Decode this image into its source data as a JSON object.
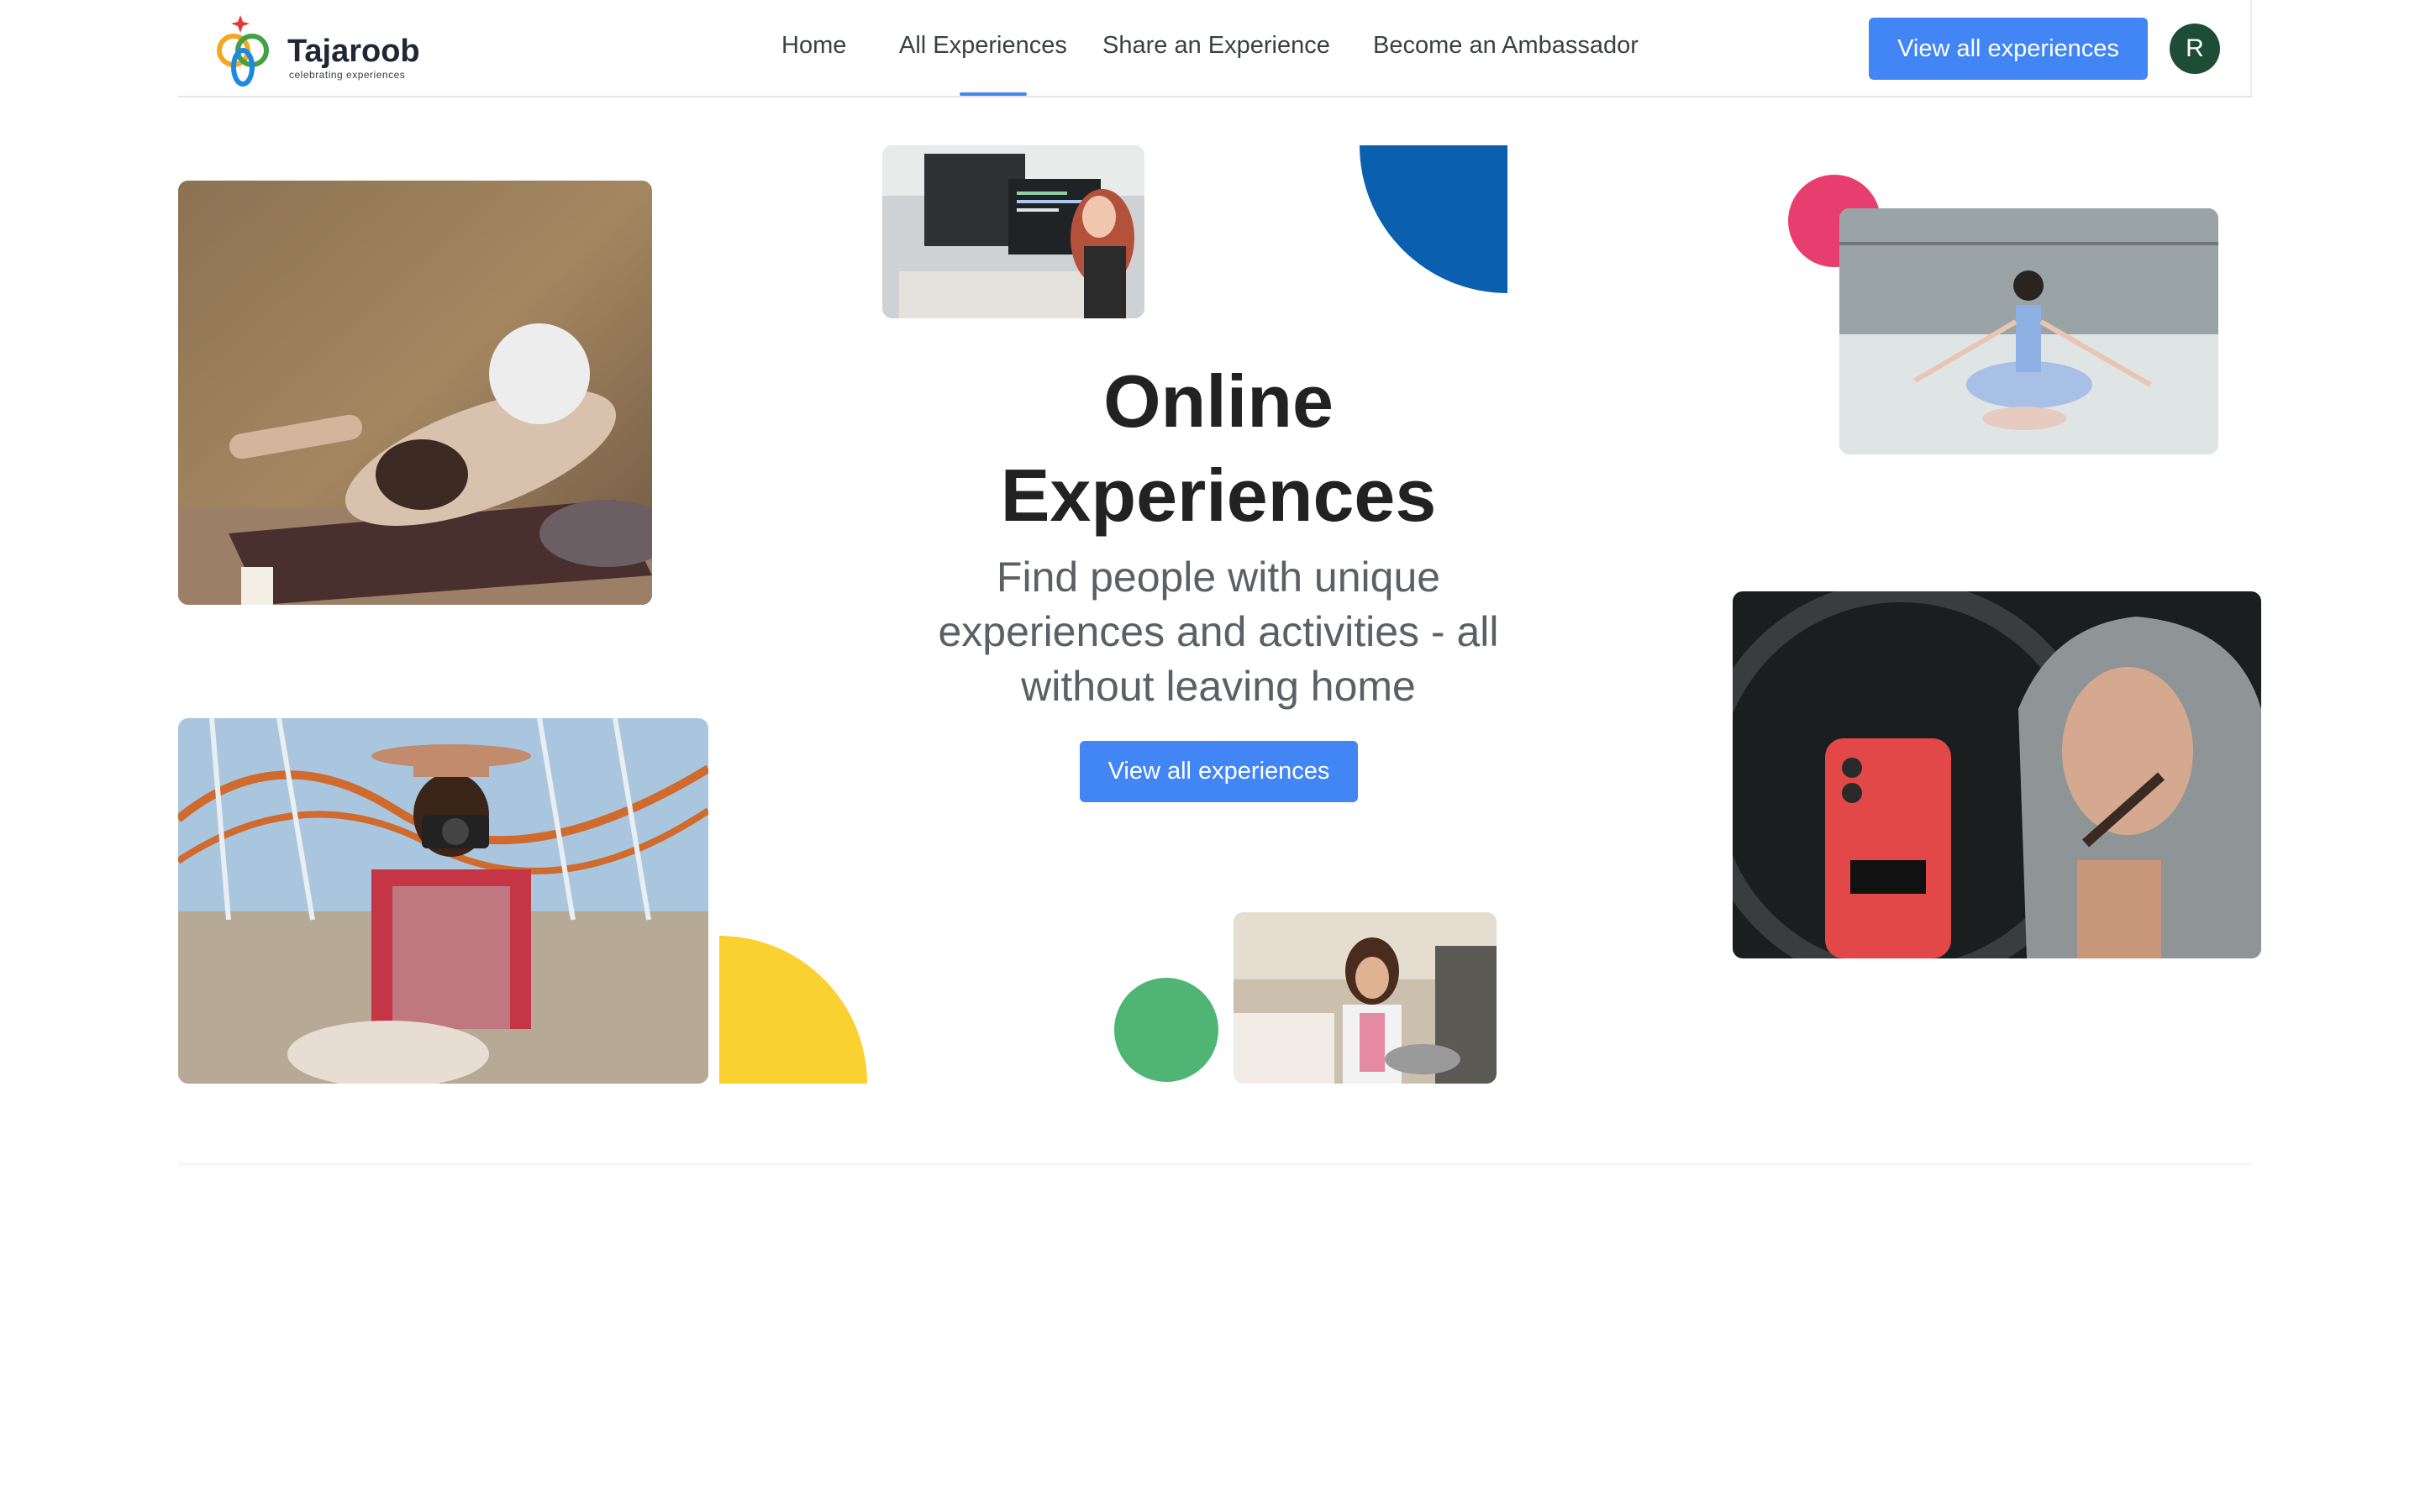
{
  "brand": {
    "name": "Tajaroob",
    "tagline": "celebrating experiences",
    "logo_icon": "trefoil-logo-icon"
  },
  "nav": {
    "items": [
      {
        "label": "Home",
        "active": true
      },
      {
        "label": "All Experiences",
        "active": false
      },
      {
        "label": "Share an Experience",
        "active": false
      },
      {
        "label": "Become an Ambassador",
        "active": false
      }
    ],
    "cta_label": "View all experiences",
    "avatar_initial": "R"
  },
  "hero": {
    "title_line1": "Online",
    "title_line2": "Experiences",
    "subtitle": "Find people with unique experiences and activities - all without leaving home",
    "cta_label": "View all experiences"
  },
  "photos": [
    {
      "subject": "yoga-stretch-photo"
    },
    {
      "subject": "programmer-at-desk-photo"
    },
    {
      "subject": "ballet-dancer-photo"
    },
    {
      "subject": "photographer-with-camera-photo"
    },
    {
      "subject": "makeup-vlogger-photo"
    },
    {
      "subject": "cooking-woman-photo"
    }
  ],
  "colors": {
    "accent": "#4285f4",
    "blue_shape": "#0b5faf",
    "pink_shape": "#e83e6f",
    "yellow_shape": "#fbd031",
    "green_shape": "#4fb474",
    "avatar_bg": "#1e4d35"
  }
}
